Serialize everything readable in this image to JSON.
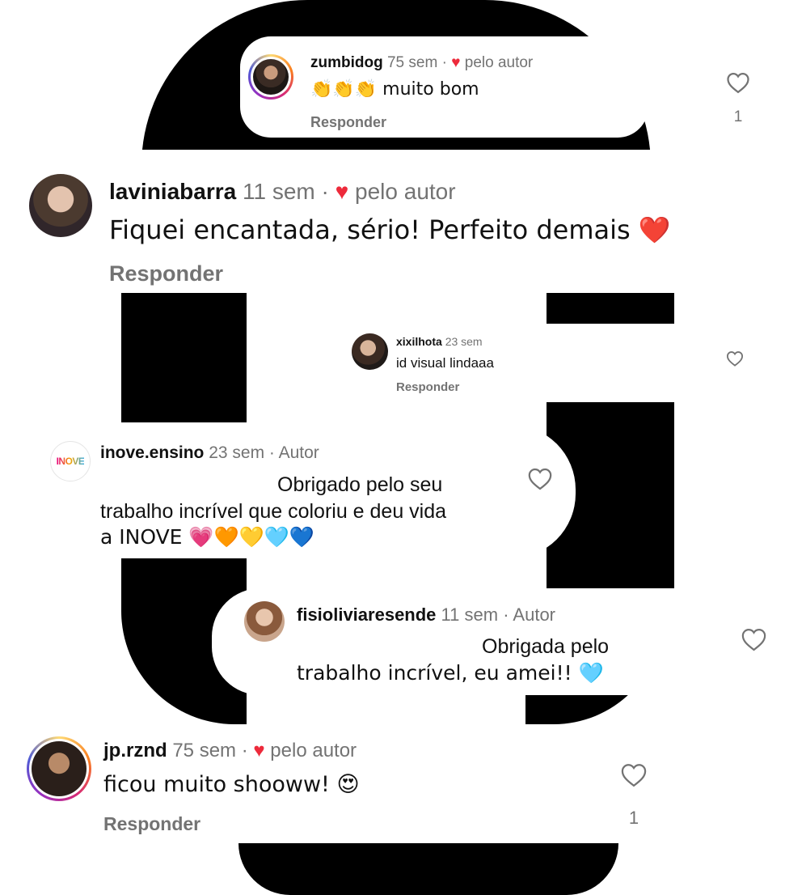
{
  "comments": [
    {
      "username": "zumbidog",
      "time": "75 sem",
      "separator": "·",
      "badge": "pelo autor",
      "text": "👏👏👏 muito bom",
      "reply": "Responder",
      "likes": "1"
    },
    {
      "username": "laviniabarra",
      "time": "11 sem",
      "separator": "·",
      "badge": "pelo autor",
      "text": "Fiquei encantada, sério! Perfeito demais ❤️",
      "reply": "Responder"
    },
    {
      "username": "xixilhota",
      "time": "23 sem",
      "text": "id visual lindaaa",
      "reply": "Responder"
    },
    {
      "username": "inove.ensino",
      "time": "23 sem",
      "separator": "·",
      "badge": "Autor",
      "text_line1": "Obrigado pelo seu",
      "text_line2": "trabalho incrível que coloriu e deu vida",
      "text_line3": "a INOVE 💗🧡💛🩵💙",
      "logo_text": "INOVE"
    },
    {
      "username": "fisioliviaresende",
      "time": "11 sem",
      "separator": "·",
      "badge": "Autor",
      "text_line1": "Obrigada pelo",
      "text_line2": "trabalho incrível, eu amei!! 🩵"
    },
    {
      "username": "jp.rznd",
      "time": "75 sem",
      "separator": "·",
      "badge": "pelo autor",
      "text": "ficou muito shooww! 😍",
      "reply": "Responder",
      "likes": "1"
    }
  ],
  "icons": {
    "like": "heart-outline-icon",
    "author_like": "heart-filled-icon"
  },
  "colors": {
    "author_heart": "#ed2a3b",
    "muted": "#737373",
    "inove_logo": [
      "#e6007e",
      "#f7a600",
      "#2aa7df"
    ]
  }
}
